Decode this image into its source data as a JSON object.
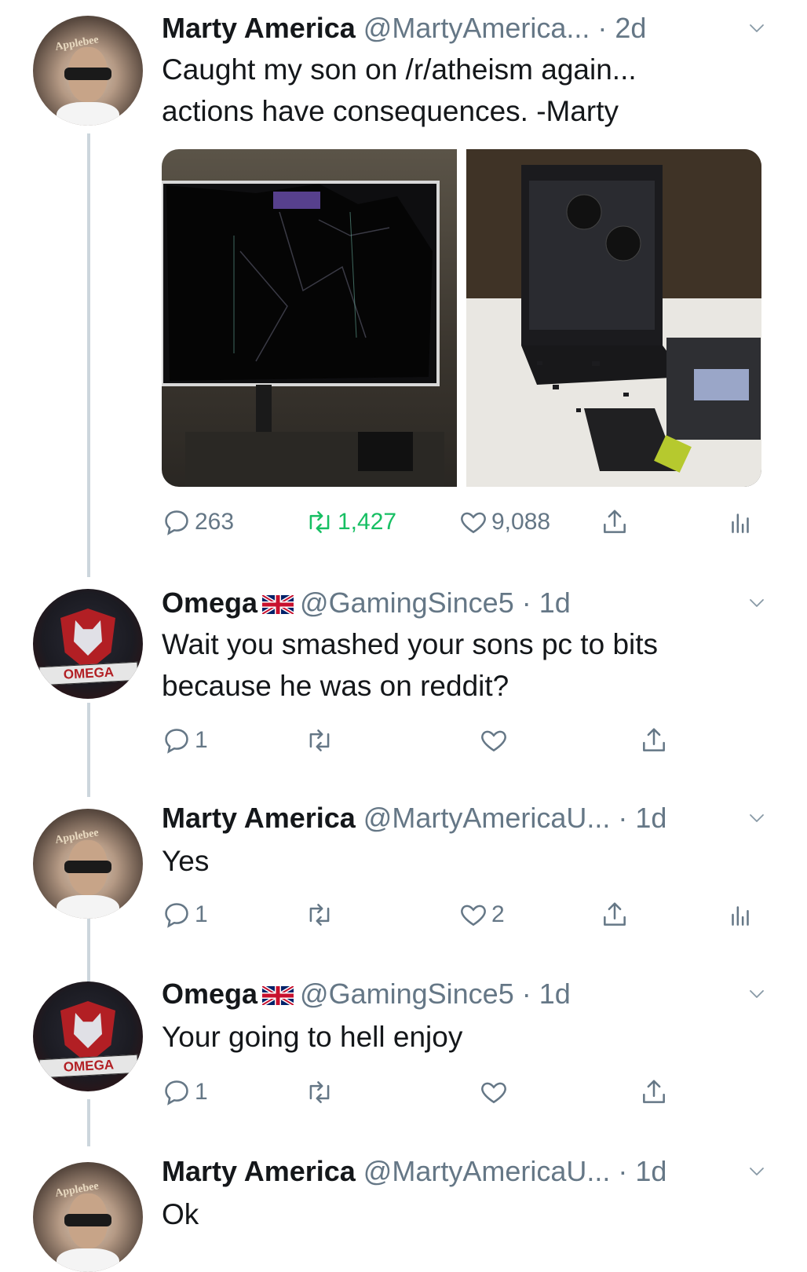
{
  "tweets": [
    {
      "name": "Marty America",
      "handle": "@MartyAmerica...",
      "time": "· 2d",
      "text_lines": [
        "Caught my son on /r/atheism again...",
        "actions have consequences. -Marty"
      ],
      "reply_count": "263",
      "retweet_count": "1,427",
      "like_count": "9,088",
      "avatar_text": "Applebee"
    },
    {
      "name": "Omega",
      "handle": "@GamingSince5 · 1d",
      "text_lines": [
        "Wait you smashed your sons pc to bits",
        "because he was on reddit?"
      ],
      "reply_count": "1",
      "avatar_text": "OMEGA"
    },
    {
      "name": "Marty America",
      "handle": "@MartyAmericaU... · 1d",
      "text_lines": [
        "Yes"
      ],
      "reply_count": "1",
      "like_count": "2",
      "avatar_text": "Applebee"
    },
    {
      "name": "Omega",
      "handle": "@GamingSince5 · 1d",
      "text_lines": [
        "Your going to hell enjoy"
      ],
      "reply_count": "1",
      "avatar_text": "OMEGA"
    },
    {
      "name": "Marty America",
      "handle": "@MartyAmericaU... · 1d",
      "text_lines": [
        "Ok"
      ],
      "avatar_text": "Applebee"
    }
  ],
  "media": {
    "left_alt": "smashed monitor",
    "right_alt": "smashed pc case"
  },
  "colors": {
    "retweet_green": "#17bf63",
    "muted_gray": "#657786",
    "thread_line": "#ccd6dd"
  }
}
